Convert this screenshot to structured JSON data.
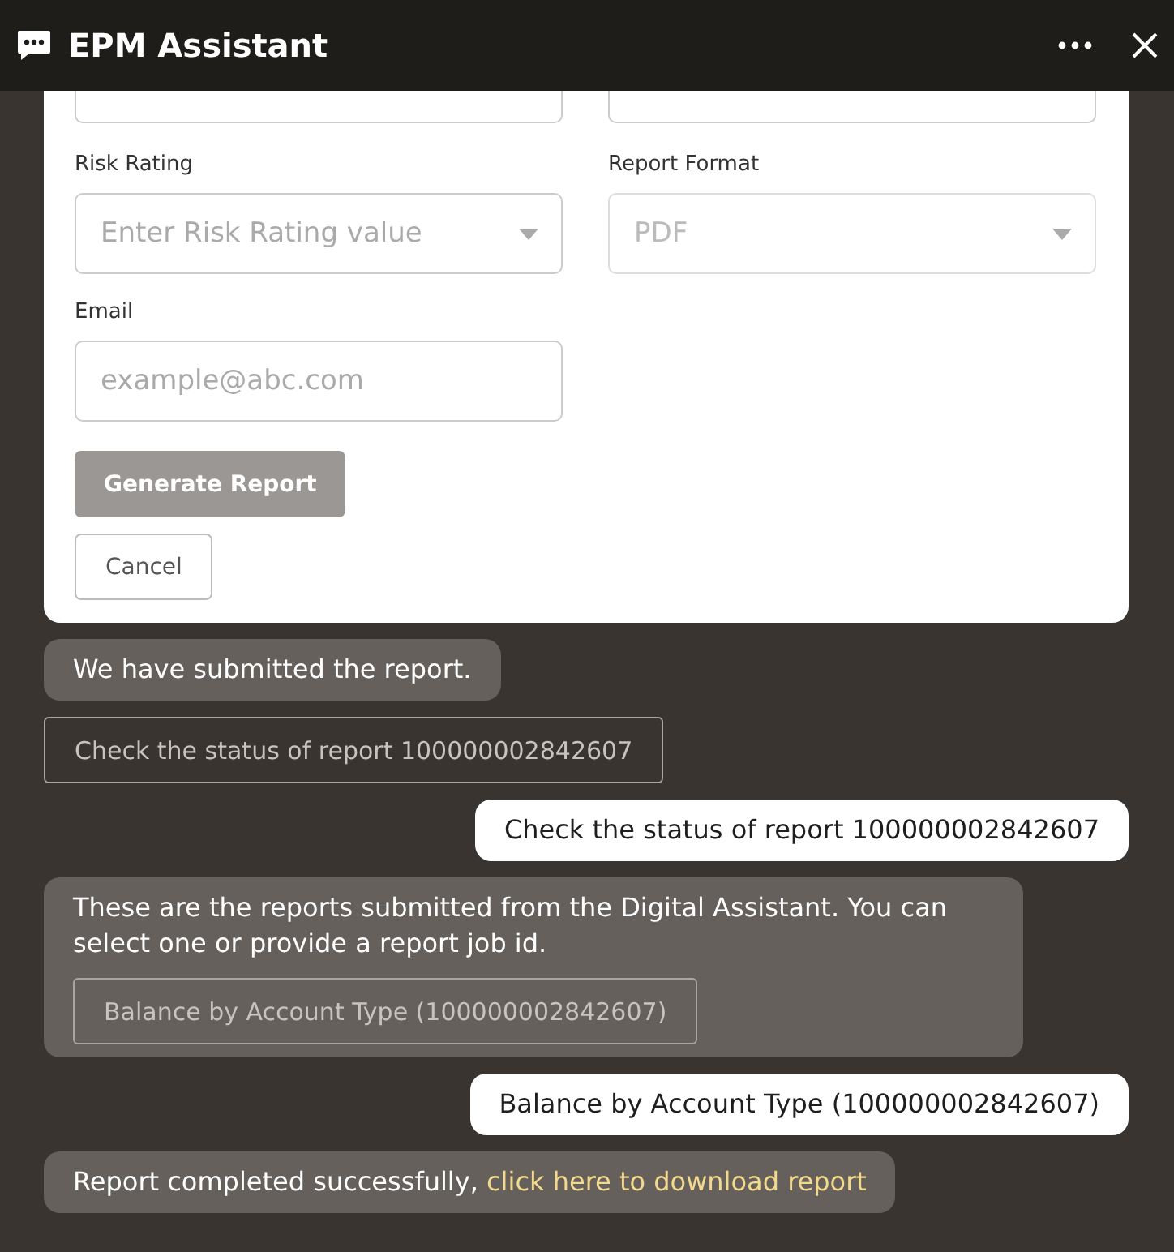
{
  "window": {
    "title": "EPM Assistant"
  },
  "form": {
    "fields": [
      {
        "label": "Risk Rating",
        "placeholder": "Enter Risk Rating value",
        "kind": "dropdown",
        "disabled": false
      },
      {
        "label": "Report Format",
        "value": "PDF",
        "kind": "dropdown",
        "disabled": true
      },
      {
        "label": "Email",
        "placeholder": "example@abc.com",
        "kind": "text",
        "disabled": false
      }
    ],
    "buttons": [
      {
        "label": "Generate Report",
        "kind": "primary",
        "disabled": true
      },
      {
        "label": "Cancel",
        "kind": "secondary",
        "disabled": false
      }
    ]
  },
  "messages": [
    {
      "kind": "bot",
      "text": "We have submitted the report."
    },
    {
      "kind": "action",
      "text": "Check the status of report 100000002842607"
    },
    {
      "kind": "user",
      "text": "Check the status of report 100000002842607"
    },
    {
      "kind": "bot",
      "text": "These are the reports submitted from the Digital Assistant. You can select one or provide a report job id.",
      "action": "Balance by Account Type (100000002842607)"
    },
    {
      "kind": "user",
      "text": "Balance by Account Type (100000002842607)"
    },
    {
      "kind": "bot",
      "text": "Report completed successfully,",
      "link": "click here to download report"
    }
  ]
}
